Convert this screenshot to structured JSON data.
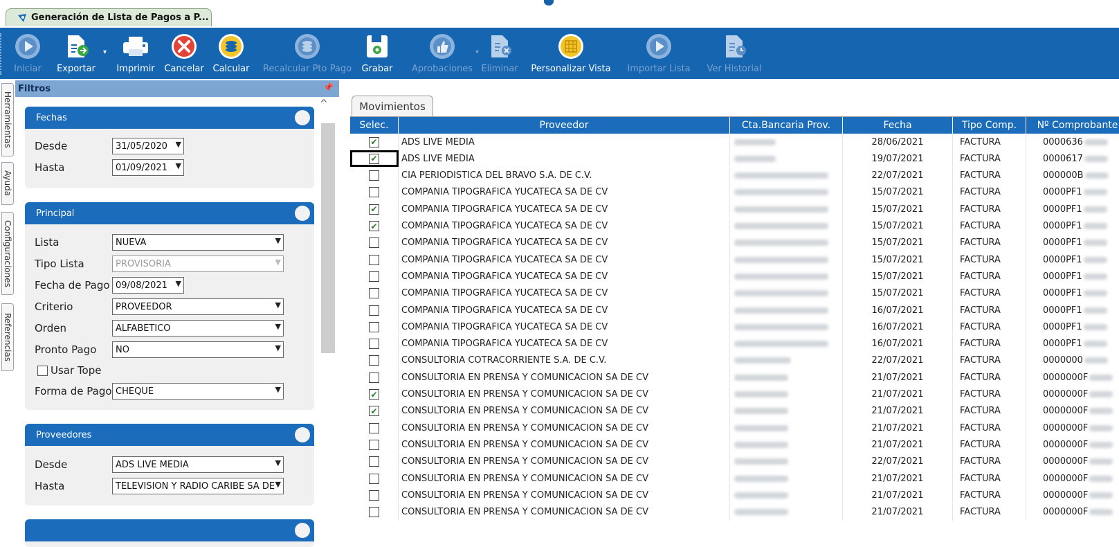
{
  "window": {
    "tab_title": "Generación de Lista de Pagos a P..."
  },
  "toolbar": {
    "buttons": [
      {
        "key": "iniciar",
        "label": "Iniciar",
        "enabled": false,
        "icon": "play-icon"
      },
      {
        "key": "exportar",
        "label": "Exportar",
        "enabled": true,
        "icon": "export-icon"
      },
      {
        "key": "imprimir",
        "label": "Imprimir",
        "enabled": true,
        "icon": "printer-icon"
      },
      {
        "key": "cancelar",
        "label": "Cancelar",
        "enabled": true,
        "icon": "cancel-icon"
      },
      {
        "key": "calcular",
        "label": "Calcular",
        "enabled": true,
        "icon": "calculate-icon"
      },
      {
        "key": "recalcular",
        "label": "Recalcular Pto Pago",
        "enabled": false,
        "icon": "recalculate-icon"
      },
      {
        "key": "grabar",
        "label": "Grabar",
        "enabled": true,
        "icon": "save-icon"
      },
      {
        "key": "aprobaciones",
        "label": "Aprobaciones",
        "enabled": false,
        "icon": "thumbs-up-icon"
      },
      {
        "key": "eliminar",
        "label": "Eliminar",
        "enabled": false,
        "icon": "delete-document-icon"
      },
      {
        "key": "personalizar",
        "label": "Personalizar Vista",
        "enabled": true,
        "icon": "grid-view-icon"
      },
      {
        "key": "importar",
        "label": "Importar Lista",
        "enabled": false,
        "icon": "play-icon"
      },
      {
        "key": "historial",
        "label": "Ver Historial",
        "enabled": false,
        "icon": "history-document-icon"
      }
    ]
  },
  "side_tabs": [
    "Herramientas",
    "Ayuda",
    "Configuraciones",
    "Referencias"
  ],
  "filters": {
    "title": "Filtros",
    "fechas": {
      "title": "Fechas",
      "desde_label": "Desde",
      "desde": "31/05/2020",
      "hasta_label": "Hasta",
      "hasta": "01/09/2021"
    },
    "principal": {
      "title": "Principal",
      "lista_label": "Lista",
      "lista": "NUEVA",
      "tipo_lista_label": "Tipo Lista",
      "tipo_lista": "PROVISORIA",
      "fecha_pago_label": "Fecha de Pago",
      "fecha_pago": "09/08/2021",
      "criterio_label": "Criterio",
      "criterio": "PROVEEDOR",
      "orden_label": "Orden",
      "orden": "ALFABETICO",
      "pronto_pago_label": "Pronto Pago",
      "pronto_pago": "NO",
      "usar_tope_label": "Usar Tope",
      "usar_tope": false,
      "forma_pago_label": "Forma de Pago",
      "forma_pago": "CHEQUE"
    },
    "proveedores": {
      "title": "Proveedores",
      "desde_label": "Desde",
      "desde": "ADS LIVE MEDIA",
      "hasta_label": "Hasta",
      "hasta": "TELEVISION Y RADIO CARIBE SA DE"
    }
  },
  "movimientos": {
    "tab_label": "Movimientos",
    "columns": [
      "Selec.",
      "Proveedor",
      "Cta.Bancaria Prov.",
      "Fecha",
      "Tipo Comp.",
      "Nº Comprobante"
    ],
    "rows": [
      {
        "sel": true,
        "proveedor": "ADS LIVE MEDIA",
        "fecha": "28/06/2021",
        "tipo": "FACTURA",
        "num": "0000636"
      },
      {
        "sel": true,
        "proveedor": "ADS LIVE MEDIA",
        "fecha": "19/07/2021",
        "tipo": "FACTURA",
        "num": "0000617"
      },
      {
        "sel": false,
        "proveedor": "CIA PERIODISTICA DEL BRAVO S.A. DE C.V.",
        "fecha": "22/07/2021",
        "tipo": "FACTURA",
        "num": "000000B"
      },
      {
        "sel": false,
        "proveedor": "COMPANIA TIPOGRAFICA YUCATECA SA DE CV",
        "fecha": "15/07/2021",
        "tipo": "FACTURA",
        "num": "0000PF1"
      },
      {
        "sel": true,
        "proveedor": "COMPANIA TIPOGRAFICA YUCATECA SA DE CV",
        "fecha": "15/07/2021",
        "tipo": "FACTURA",
        "num": "0000PF1"
      },
      {
        "sel": true,
        "proveedor": "COMPANIA TIPOGRAFICA YUCATECA SA DE CV",
        "fecha": "15/07/2021",
        "tipo": "FACTURA",
        "num": "0000PF1"
      },
      {
        "sel": false,
        "proveedor": "COMPANIA TIPOGRAFICA YUCATECA SA DE CV",
        "fecha": "15/07/2021",
        "tipo": "FACTURA",
        "num": "0000PF1"
      },
      {
        "sel": false,
        "proveedor": "COMPANIA TIPOGRAFICA YUCATECA SA DE CV",
        "fecha": "15/07/2021",
        "tipo": "FACTURA",
        "num": "0000PF1"
      },
      {
        "sel": false,
        "proveedor": "COMPANIA TIPOGRAFICA YUCATECA SA DE CV",
        "fecha": "15/07/2021",
        "tipo": "FACTURA",
        "num": "0000PF1"
      },
      {
        "sel": false,
        "proveedor": "COMPANIA TIPOGRAFICA YUCATECA SA DE CV",
        "fecha": "15/07/2021",
        "tipo": "FACTURA",
        "num": "0000PF1"
      },
      {
        "sel": false,
        "proveedor": "COMPANIA TIPOGRAFICA YUCATECA SA DE CV",
        "fecha": "16/07/2021",
        "tipo": "FACTURA",
        "num": "0000PF1"
      },
      {
        "sel": false,
        "proveedor": "COMPANIA TIPOGRAFICA YUCATECA SA DE CV",
        "fecha": "16/07/2021",
        "tipo": "FACTURA",
        "num": "0000PF1"
      },
      {
        "sel": false,
        "proveedor": "COMPANIA TIPOGRAFICA YUCATECA SA DE CV",
        "fecha": "16/07/2021",
        "tipo": "FACTURA",
        "num": "0000PF1"
      },
      {
        "sel": false,
        "proveedor": "CONSULTORIA COTRACORRIENTE S.A. DE C.V.",
        "fecha": "22/07/2021",
        "tipo": "FACTURA",
        "num": "0000000"
      },
      {
        "sel": false,
        "proveedor": "CONSULTORIA EN PRENSA Y COMUNICACION SA DE CV",
        "fecha": "21/07/2021",
        "tipo": "FACTURA",
        "num": "0000000F"
      },
      {
        "sel": true,
        "proveedor": "CONSULTORIA EN PRENSA Y COMUNICACION SA DE CV",
        "fecha": "21/07/2021",
        "tipo": "FACTURA",
        "num": "0000000F"
      },
      {
        "sel": true,
        "proveedor": "CONSULTORIA EN PRENSA Y COMUNICACION SA DE CV",
        "fecha": "21/07/2021",
        "tipo": "FACTURA",
        "num": "0000000F"
      },
      {
        "sel": false,
        "proveedor": "CONSULTORIA EN PRENSA Y COMUNICACION SA DE CV",
        "fecha": "21/07/2021",
        "tipo": "FACTURA",
        "num": "0000000F"
      },
      {
        "sel": false,
        "proveedor": "CONSULTORIA EN PRENSA Y COMUNICACION SA DE CV",
        "fecha": "21/07/2021",
        "tipo": "FACTURA",
        "num": "0000000F"
      },
      {
        "sel": false,
        "proveedor": "CONSULTORIA EN PRENSA Y COMUNICACION SA DE CV",
        "fecha": "22/07/2021",
        "tipo": "FACTURA",
        "num": "0000000F"
      },
      {
        "sel": false,
        "proveedor": "CONSULTORIA EN PRENSA Y COMUNICACION SA DE CV",
        "fecha": "21/07/2021",
        "tipo": "FACTURA",
        "num": "0000000F"
      },
      {
        "sel": false,
        "proveedor": "CONSULTORIA EN PRENSA Y COMUNICACION SA DE CV",
        "fecha": "21/07/2021",
        "tipo": "FACTURA",
        "num": "0000000F"
      },
      {
        "sel": false,
        "proveedor": "CONSULTORIA EN PRENSA Y COMUNICACION SA DE CV",
        "fecha": "21/07/2021",
        "tipo": "FACTURA",
        "num": "0000000F"
      }
    ]
  }
}
